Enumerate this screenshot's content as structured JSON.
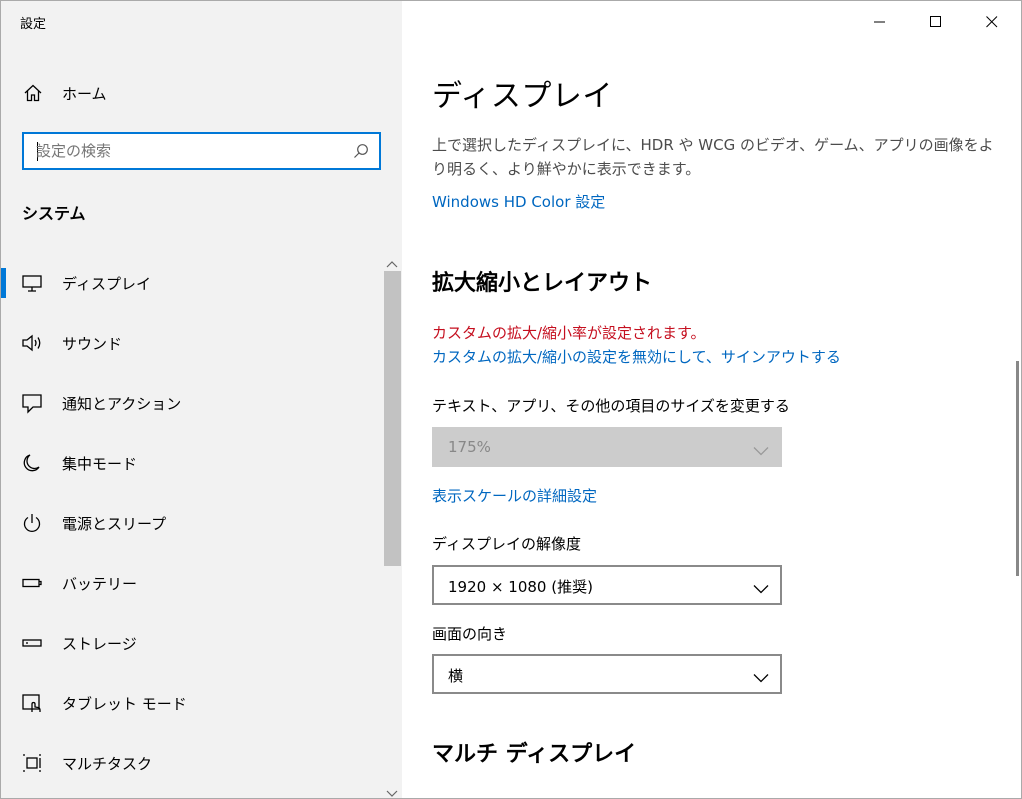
{
  "window": {
    "app_title": "設定",
    "controls": {
      "minimize": "minimize",
      "maximize": "maximize",
      "close": "close"
    }
  },
  "sidebar": {
    "home_label": "ホーム",
    "search_placeholder": "設定の検索",
    "section_heading": "システム",
    "items": [
      {
        "label": "ディスプレイ",
        "icon": "monitor-icon",
        "active": true
      },
      {
        "label": "サウンド",
        "icon": "speaker-icon",
        "active": false
      },
      {
        "label": "通知とアクション",
        "icon": "notification-icon",
        "active": false
      },
      {
        "label": "集中モード",
        "icon": "moon-icon",
        "active": false
      },
      {
        "label": "電源とスリープ",
        "icon": "power-icon",
        "active": false
      },
      {
        "label": "バッテリー",
        "icon": "battery-icon",
        "active": false
      },
      {
        "label": "ストレージ",
        "icon": "storage-icon",
        "active": false
      },
      {
        "label": "タブレット モード",
        "icon": "tablet-mode-icon",
        "active": false
      },
      {
        "label": "マルチタスク",
        "icon": "multitask-icon",
        "active": false
      }
    ]
  },
  "content": {
    "title": "ディスプレイ",
    "description": "上で選択したディスプレイに、HDR や WCG のビデオ、ゲーム、アプリの画像をより明るく、より鮮やかに表示できます。",
    "hd_color_link": "Windows HD Color 設定",
    "scale_section": {
      "heading": "拡大縮小とレイアウト",
      "warning": "カスタムの拡大/縮小率が設定されます。",
      "disable_link": "カスタムの拡大/縮小の設定を無効にして、サインアウトする",
      "size_label": "テキスト、アプリ、その他の項目のサイズを変更する",
      "size_value": "175%",
      "advanced_link": "表示スケールの詳細設定",
      "resolution_label": "ディスプレイの解像度",
      "resolution_value": "1920 × 1080 (推奨)",
      "orientation_label": "画面の向き",
      "orientation_value": "横"
    },
    "multi_display": {
      "heading": "マルチ ディスプレイ"
    }
  },
  "colors": {
    "accent": "#0078d7",
    "link": "#0067c0",
    "warning": "#c50f1f",
    "sidebar_bg": "#f2f2f2"
  }
}
